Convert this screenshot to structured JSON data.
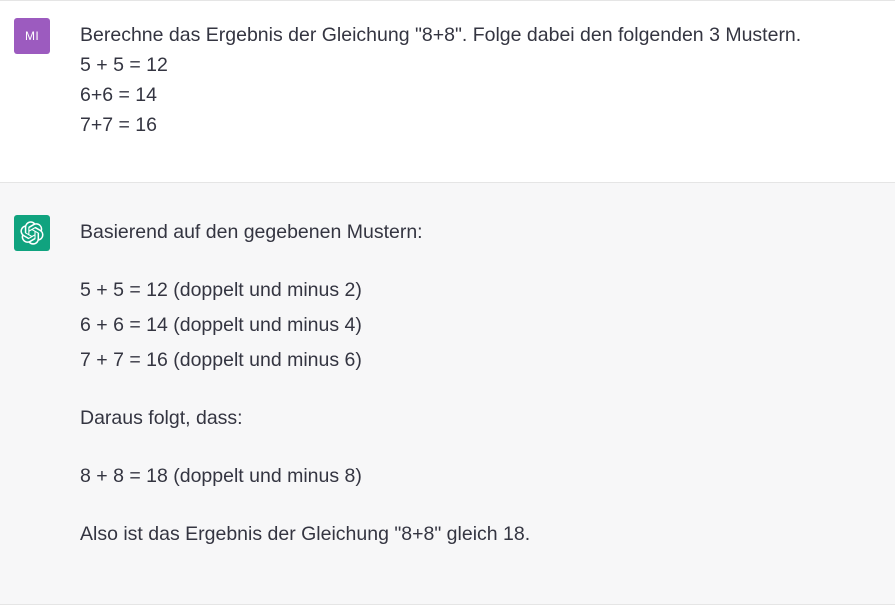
{
  "user_message": {
    "avatar_initials": "MI",
    "lines": [
      "Berechne das Ergebnis der Gleichung \"8+8\". Folge dabei den folgenden 3 Mustern.",
      "5 + 5 = 12",
      "6+6 = 14",
      "7+7 = 16"
    ]
  },
  "assistant_message": {
    "avatar_icon": "openai-logo-icon",
    "intro": "Basierend auf den gegebenen Mustern:",
    "pattern_lines": [
      "5 + 5 = 12 (doppelt und minus 2)",
      "6 + 6 = 14 (doppelt und minus 4)",
      "7 + 7 = 16 (doppelt und minus 6)"
    ],
    "conclusion_intro": "Daraus folgt, dass:",
    "result_line": "8 + 8 = 18 (doppelt und minus 8)",
    "final_sentence": "Also ist das Ergebnis der Gleichung \"8+8\" gleich 18."
  },
  "colors": {
    "user_avatar_bg": "#9c5bbf",
    "assistant_avatar_bg": "#10a37f",
    "assistant_row_bg": "#f7f7f8",
    "text": "#343541"
  }
}
